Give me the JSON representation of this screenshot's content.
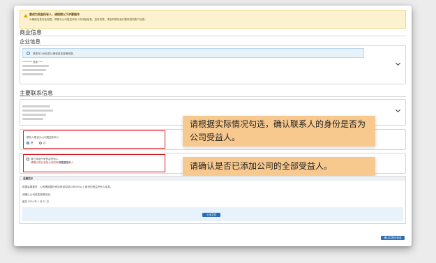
{
  "alert": {
    "title": "要成为受益所有人，请按照以下步骤操作",
    "body": "为确保信息安全完整，请核对公司受益所有人的详细信息。如有变更，请及时联系我们更新您的账户信息。"
  },
  "business_info": {
    "heading": "商业信息"
  },
  "company_info": {
    "heading": "企业信息",
    "notice": "请填写公司信息以确保信息准确完整。",
    "lines": [
      "********** 信息 ****",
      "**** ******",
      "***** ** ***",
      "********"
    ]
  },
  "contact": {
    "heading": "主要联系信息",
    "lines": [
      "*******",
      "***********",
      "******** ***",
      "*******"
    ]
  },
  "beneficiary_question": {
    "label": "联系人是否为公司受益所有人",
    "options": [
      "是",
      "否"
    ],
    "selected": "是"
  },
  "added_all": {
    "label": "我已添加所有受益所有人",
    "sub_red": "请确认您已添加公司的所有受益所有人",
    "sub_blue": "添加受益人"
  },
  "callouts": {
    "first": "请根据实际情况勾选，确认联系人的身份是否为公司受益人。",
    "second": "请确认是否已添加公司的全部受益人。"
  },
  "notice": {
    "header": "温馨提示",
    "lines": [
      "根据监管要求，公司需披露所有持有或控制公司25%以上股份的受益所有人信息。",
      "请确认公司信息准确无误。",
      "截至 2024 年 1 月 31 日"
    ],
    "upload_button": "上传文件"
  },
  "footer": {
    "confirm_button": "确认并提交信息"
  },
  "colors": {
    "accent": "#2c6eb5",
    "highlight_border": "#e0141d",
    "callout_bg": "#f8c98f"
  }
}
